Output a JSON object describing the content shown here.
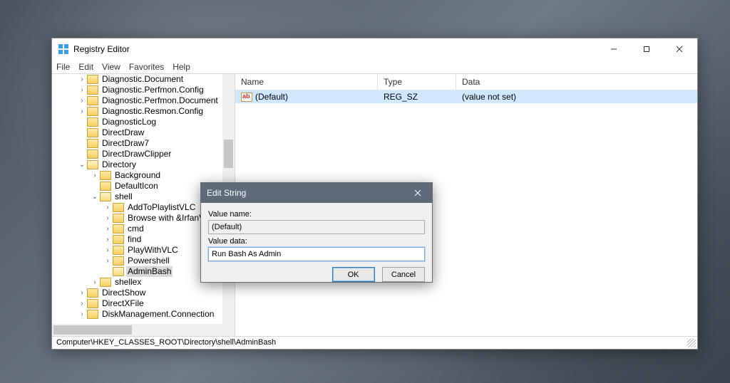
{
  "window": {
    "title": "Registry Editor",
    "menu": [
      "File",
      "Edit",
      "View",
      "Favorites",
      "Help"
    ],
    "path": "Computer\\HKEY_CLASSES_ROOT\\Directory\\shell\\AdminBash"
  },
  "tree": [
    {
      "indent": 0,
      "exp": ">",
      "label": "Diagnostic.Document"
    },
    {
      "indent": 0,
      "exp": ">",
      "label": "Diagnostic.Perfmon.Config"
    },
    {
      "indent": 0,
      "exp": ">",
      "label": "Diagnostic.Perfmon.Document"
    },
    {
      "indent": 0,
      "exp": ">",
      "label": "Diagnostic.Resmon.Config"
    },
    {
      "indent": 0,
      "exp": "",
      "label": "DiagnosticLog"
    },
    {
      "indent": 0,
      "exp": "",
      "label": "DirectDraw"
    },
    {
      "indent": 0,
      "exp": "",
      "label": "DirectDraw7"
    },
    {
      "indent": 0,
      "exp": "",
      "label": "DirectDrawClipper"
    },
    {
      "indent": 0,
      "exp": "v",
      "label": "Directory",
      "open": true
    },
    {
      "indent": 1,
      "exp": ">",
      "label": "Background"
    },
    {
      "indent": 1,
      "exp": "",
      "label": "DefaultIcon"
    },
    {
      "indent": 1,
      "exp": "v",
      "label": "shell",
      "open": true
    },
    {
      "indent": 2,
      "exp": ">",
      "label": "AddToPlaylistVLC"
    },
    {
      "indent": 2,
      "exp": ">",
      "label": "Browse with &IrfanView"
    },
    {
      "indent": 2,
      "exp": ">",
      "label": "cmd"
    },
    {
      "indent": 2,
      "exp": ">",
      "label": "find"
    },
    {
      "indent": 2,
      "exp": ">",
      "label": "PlayWithVLC"
    },
    {
      "indent": 2,
      "exp": ">",
      "label": "Powershell"
    },
    {
      "indent": 2,
      "exp": "",
      "label": "AdminBash",
      "open": true,
      "selected": true
    },
    {
      "indent": 1,
      "exp": ">",
      "label": "shellex"
    },
    {
      "indent": 0,
      "exp": ">",
      "label": "DirectShow"
    },
    {
      "indent": 0,
      "exp": ">",
      "label": "DirectXFile"
    },
    {
      "indent": 0,
      "exp": ">",
      "label": "DiskManagement.Connection"
    }
  ],
  "list": {
    "columns": {
      "name": "Name",
      "type": "Type",
      "data": "Data"
    },
    "row": {
      "name": "(Default)",
      "type": "REG_SZ",
      "data": "(value not set)"
    }
  },
  "dialog": {
    "title": "Edit String",
    "name_label": "Value name:",
    "name_value": "(Default)",
    "data_label": "Value data:",
    "data_value": "Run Bash As Admin",
    "ok": "OK",
    "cancel": "Cancel"
  }
}
